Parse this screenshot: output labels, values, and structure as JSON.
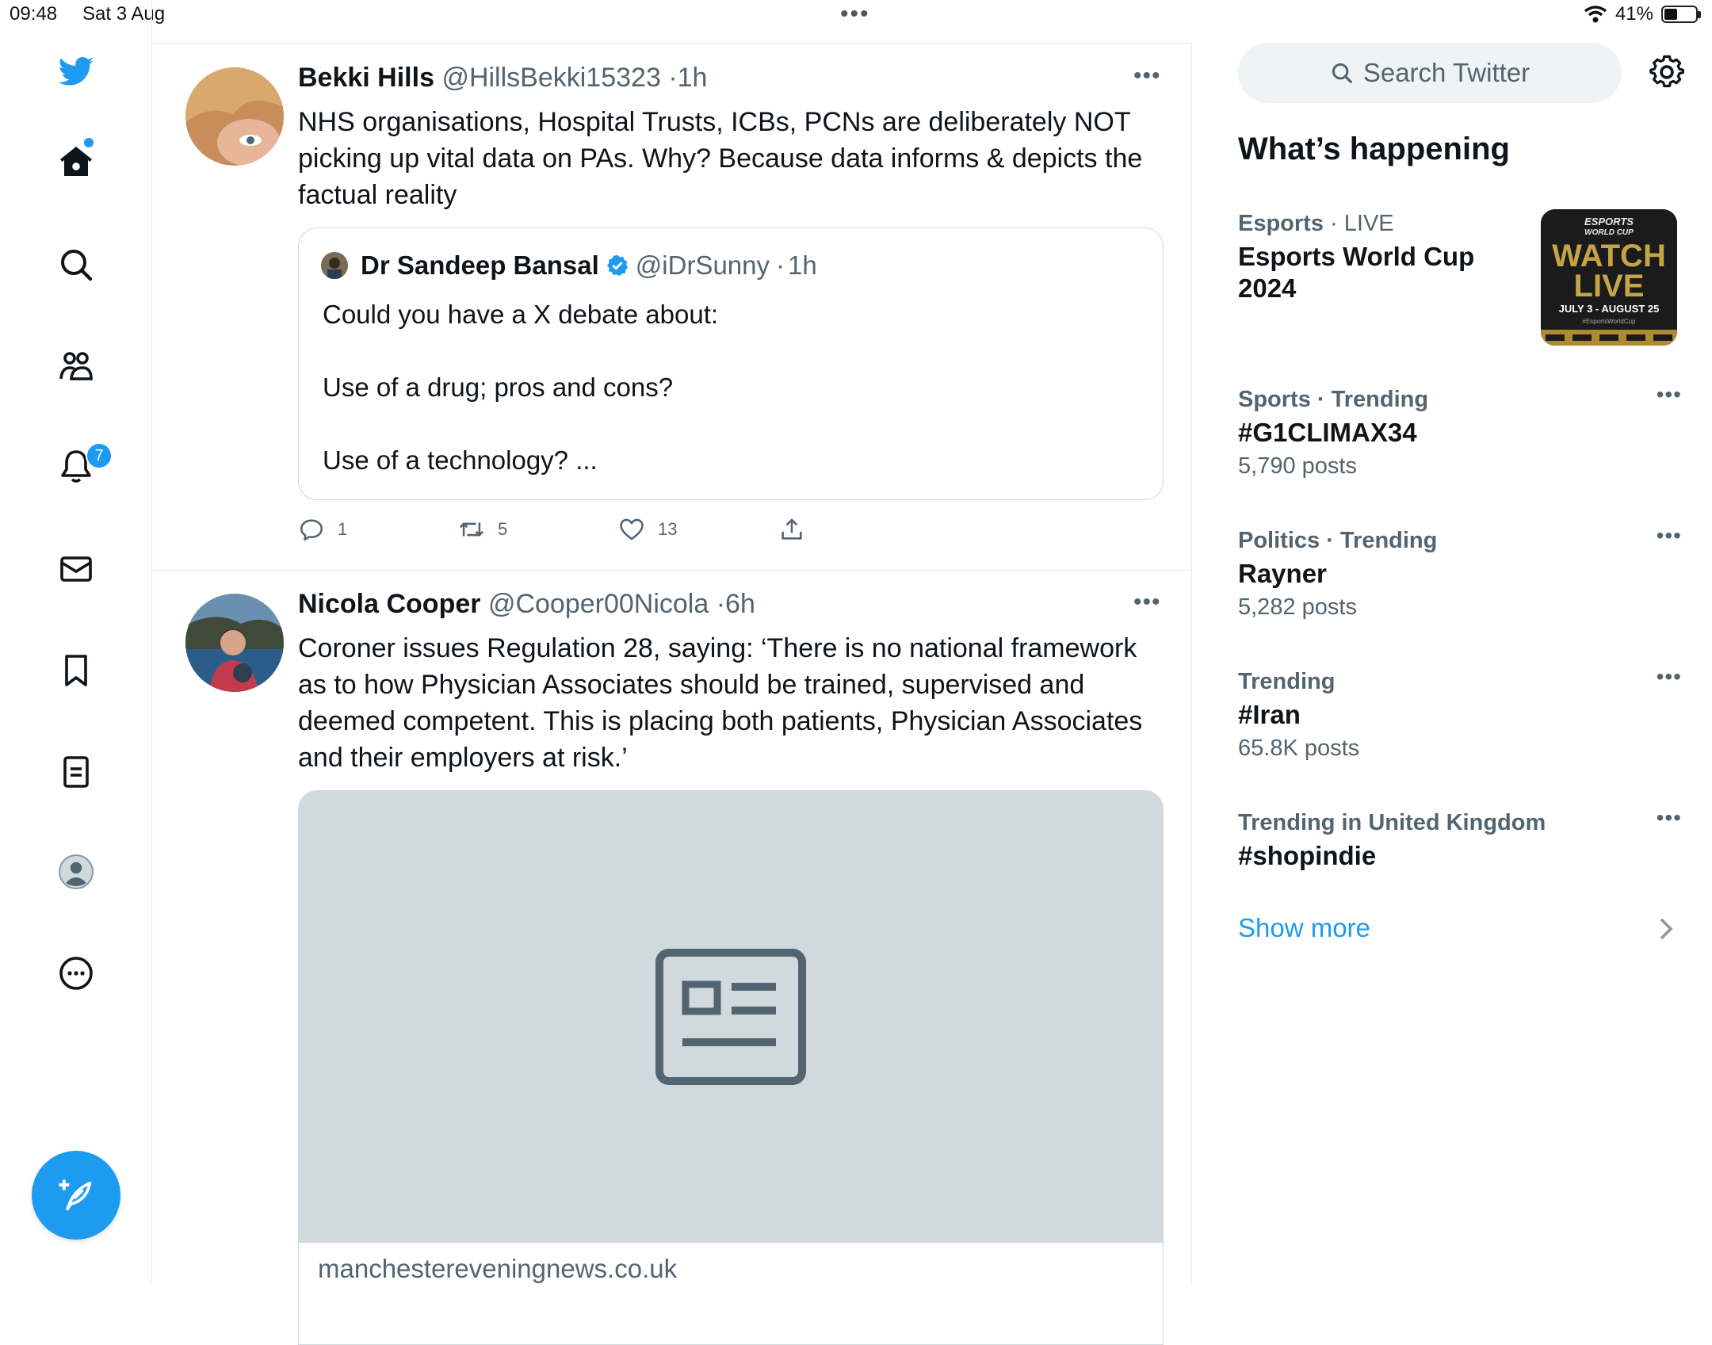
{
  "status_bar": {
    "time": "09:48",
    "date": "Sat 3 Aug",
    "battery": "41%",
    "battery_level": 0.41
  },
  "nav": {
    "items": [
      "home",
      "explore",
      "communities",
      "notifications",
      "messages",
      "bookmarks",
      "lists",
      "profile",
      "more"
    ],
    "notifications_badge": "7"
  },
  "colors": {
    "accent": "#1d9bf0",
    "text": "#0f1419",
    "secondary": "#536471",
    "border": "#e7e9ea"
  },
  "tweets": [
    {
      "name": "Bekki Hills",
      "handle": "@HillsBekki15323",
      "time": "1h",
      "text": "NHS organisations, Hospital Trusts, ICBs, PCNs are deliberately NOT picking up vital data on PAs. Why? Because data informs & depicts the factual reality",
      "quote": {
        "name": "Dr Sandeep Bansal",
        "handle": "@iDrSunny",
        "time": "1h",
        "lines": [
          "Could you have a X debate about:",
          "Use of a drug; pros and cons?",
          "Use of a technology? ..."
        ]
      },
      "replies": "1",
      "retweets": "5",
      "likes": "13"
    },
    {
      "name": "Nicola Cooper",
      "handle": "@Cooper00Nicola",
      "time": "6h",
      "text": "Coroner issues Regulation 28, saying: ‘There is no national framework as to how Physician Associates should be trained, supervised and deemed competent. This is placing both patients, Physician Associates and their employers at risk.’",
      "card_domain": "manchestereveningnews.co.uk"
    }
  ],
  "sidebar": {
    "search_placeholder": "Search Twitter",
    "title": "What’s happening",
    "trends": [
      {
        "category": "Esports",
        "meta": "LIVE",
        "name": "Esports World Cup 2024",
        "image_text": [
          "ESPORTS",
          "WORLD CUP",
          "WATCH",
          "LIVE",
          "JULY 3 - AUGUST 25",
          "#EsportsWorldCup"
        ]
      },
      {
        "category": "Sports · Trending",
        "name": "#G1CLIMAX34",
        "count": "5,790 posts"
      },
      {
        "category": "Politics · Trending",
        "name": "Rayner",
        "count": "5,282 posts"
      },
      {
        "category": "Trending",
        "name": "#Iran",
        "count": "65.8K posts"
      },
      {
        "category": "Trending in United Kingdom",
        "name": "#shopindie"
      }
    ],
    "show_more": "Show more"
  }
}
